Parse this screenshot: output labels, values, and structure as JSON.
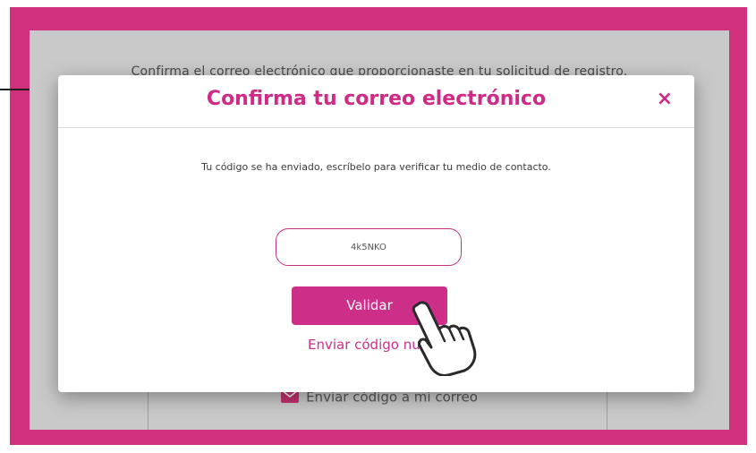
{
  "background": {
    "instruction_text": "Confirma el correo electrónico que proporcionaste en tu solicitud de registro.",
    "send_email_label": "Enviar código a mi correo"
  },
  "modal": {
    "title": "Confirma tu correo electrónico",
    "close_symbol": "×",
    "message": "Tu código se ha enviado, escríbelo para verificar tu medio de contacto.",
    "code_value": "4k5NKO",
    "validate_label": "Validar",
    "resend_label": "Enviar código nuevo"
  },
  "colors": {
    "accent": "#cd2e87",
    "frame": "#d1307f",
    "backdrop": "#c9c9c9"
  },
  "icons": [
    "envelope-icon",
    "pointing-hand-icon",
    "close-icon"
  ]
}
